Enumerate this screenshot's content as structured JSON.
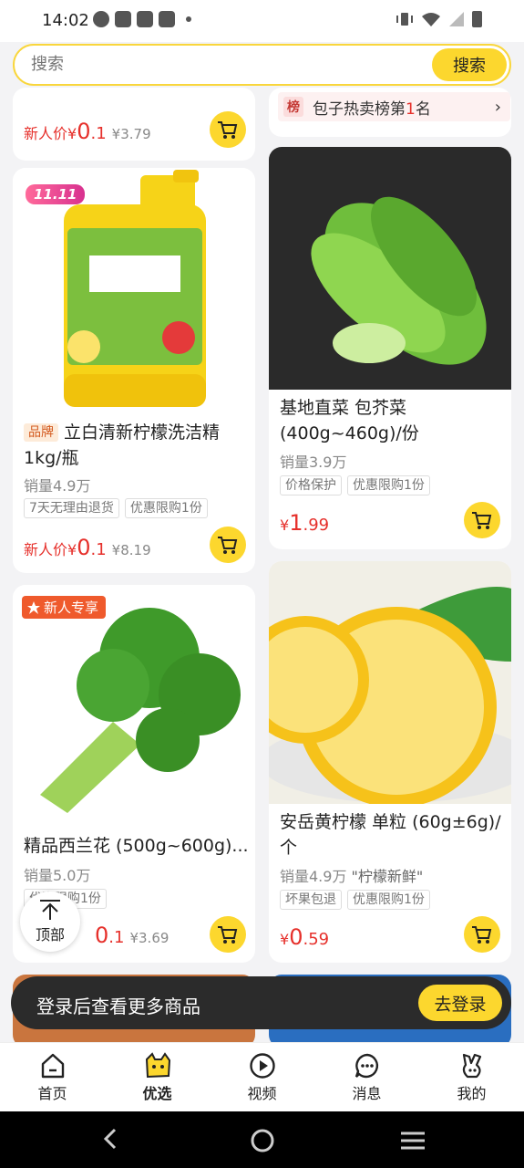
{
  "status_bar": {
    "time": "14:02"
  },
  "search": {
    "placeholder": "搜索",
    "button": "搜索"
  },
  "top_left_card": {
    "new_user_label": "新人价",
    "currency": "¥",
    "price_int": "0",
    "price_dec": ".1",
    "old_price": "¥3.79"
  },
  "top_right_card": {
    "rank_icon": "榜",
    "rank_prefix": "包子热卖榜第",
    "rank_number": "1",
    "rank_suffix": "名"
  },
  "products": [
    {
      "promo": "11.11",
      "badge": "品牌",
      "name": "立白清新柠檬洗洁精1kg/瓶",
      "sales": "销量4.9万",
      "tags": [
        "7天无理由退货",
        "优惠限购1份"
      ],
      "price_label": "新人价",
      "currency": "¥",
      "price_int": "0",
      "price_dec": ".1",
      "old_price": "¥8.19"
    },
    {
      "name": "基地直菜 包芥菜 (400g~460g)/份",
      "sales": "销量3.9万",
      "tags": [
        "价格保护",
        "优惠限购1份"
      ],
      "currency": "¥",
      "price_int": "1",
      "price_dec": ".99"
    },
    {
      "promo": "新人专享",
      "name": "精品西兰花 (500g~600g)...",
      "sales": "销量5.0万",
      "tags": [
        "优惠限购1份"
      ],
      "price_int": "0",
      "price_dec": ".1",
      "old_price": "¥3.69"
    },
    {
      "name": "安岳黄柠檬 单粒 (60g±6g)/个",
      "sales": "销量4.9万",
      "sales_note": "\"柠檬新鲜\"",
      "tags": [
        "坏果包退",
        "优惠限购1份"
      ],
      "currency": "¥",
      "price_int": "0",
      "price_dec": ".59"
    }
  ],
  "top_button": {
    "label": "顶部"
  },
  "login_banner": {
    "text": "登录后查看更多商品",
    "button": "去登录"
  },
  "tabbar": [
    {
      "label": "首页",
      "icon": "home-icon"
    },
    {
      "label": "优选",
      "icon": "mascot-icon",
      "active": true
    },
    {
      "label": "视频",
      "icon": "play-icon"
    },
    {
      "label": "消息",
      "icon": "message-icon"
    },
    {
      "label": "我的",
      "icon": "rabbit-icon"
    }
  ],
  "colors": {
    "accent": "#fcd72e",
    "price": "#e6302b",
    "background": "#f3f3f5"
  }
}
